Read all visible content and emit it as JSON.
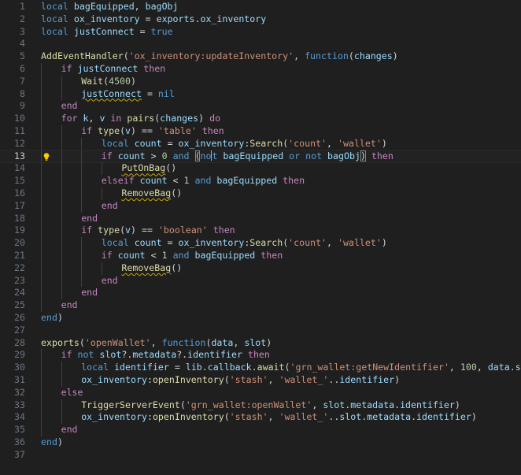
{
  "editor": {
    "language": "lua",
    "current_line": 13,
    "theme": {
      "background": "#1f1f1f",
      "keyword": "#569cd6",
      "control": "#c586c0",
      "variable": "#9cdcfe",
      "function": "#dcdcaa",
      "string": "#ce9178",
      "number": "#b5cea8",
      "line_number": "#6e7681"
    },
    "lines": [
      {
        "n": "1",
        "indent": 0,
        "tokens": [
          [
            "kw",
            "local "
          ],
          [
            "var",
            "bagEquipped"
          ],
          [
            "pun",
            ", "
          ],
          [
            "var",
            "bagObj"
          ]
        ]
      },
      {
        "n": "2",
        "indent": 0,
        "tokens": [
          [
            "kw",
            "local "
          ],
          [
            "var",
            "ox_inventory"
          ],
          [
            "op",
            " = "
          ],
          [
            "var",
            "exports"
          ],
          [
            "pun",
            "."
          ],
          [
            "var",
            "ox_inventory"
          ]
        ]
      },
      {
        "n": "3",
        "indent": 0,
        "tokens": [
          [
            "kw",
            "local "
          ],
          [
            "var",
            "justConnect"
          ],
          [
            "op",
            " = "
          ],
          [
            "kw",
            "true"
          ]
        ]
      },
      {
        "n": "4",
        "indent": 0,
        "tokens": []
      },
      {
        "n": "5",
        "indent": 0,
        "tokens": [
          [
            "fn",
            "AddEventHandler"
          ],
          [
            "pun",
            "("
          ],
          [
            "str",
            "'ox_inventory:updateInventory'"
          ],
          [
            "pun",
            ", "
          ],
          [
            "kw",
            "function"
          ],
          [
            "pun",
            "("
          ],
          [
            "var",
            "changes"
          ],
          [
            "pun",
            ")"
          ]
        ]
      },
      {
        "n": "6",
        "indent": 1,
        "tokens": [
          [
            "ctl",
            "if "
          ],
          [
            "var",
            "justConnect"
          ],
          [
            "ctl",
            " then"
          ]
        ]
      },
      {
        "n": "7",
        "indent": 2,
        "tokens": [
          [
            "fn",
            "Wait"
          ],
          [
            "pun",
            "("
          ],
          [
            "num",
            "4500"
          ],
          [
            "pun",
            ")"
          ]
        ]
      },
      {
        "n": "8",
        "indent": 2,
        "tokens": [
          [
            "var",
            "justConnect",
            "warn"
          ],
          [
            "op",
            " = "
          ],
          [
            "kw",
            "nil"
          ]
        ]
      },
      {
        "n": "9",
        "indent": 1,
        "tokens": [
          [
            "ctl",
            "end"
          ]
        ]
      },
      {
        "n": "10",
        "indent": 1,
        "tokens": [
          [
            "ctl",
            "for "
          ],
          [
            "var",
            "k"
          ],
          [
            "pun",
            ", "
          ],
          [
            "var",
            "v"
          ],
          [
            "ctl",
            " in "
          ],
          [
            "fn",
            "pairs"
          ],
          [
            "pun",
            "("
          ],
          [
            "var",
            "changes"
          ],
          [
            "pun",
            ")"
          ],
          [
            "ctl",
            " do"
          ]
        ]
      },
      {
        "n": "11",
        "indent": 2,
        "tokens": [
          [
            "ctl",
            "if "
          ],
          [
            "fn",
            "type"
          ],
          [
            "pun",
            "("
          ],
          [
            "var",
            "v"
          ],
          [
            "pun",
            ")"
          ],
          [
            "op",
            " == "
          ],
          [
            "str",
            "'table'"
          ],
          [
            "ctl",
            " then"
          ]
        ]
      },
      {
        "n": "12",
        "indent": 3,
        "tokens": [
          [
            "kw",
            "local "
          ],
          [
            "var",
            "count"
          ],
          [
            "op",
            " = "
          ],
          [
            "var",
            "ox_inventory"
          ],
          [
            "pun",
            ":"
          ],
          [
            "fn",
            "Search"
          ],
          [
            "pun",
            "("
          ],
          [
            "str",
            "'count'"
          ],
          [
            "pun",
            ", "
          ],
          [
            "str",
            "'wallet'"
          ],
          [
            "pun",
            ")"
          ]
        ]
      },
      {
        "n": "13",
        "indent": 3,
        "tokens": [
          [
            "ctl",
            "if "
          ],
          [
            "var",
            "count"
          ],
          [
            "op",
            " > "
          ],
          [
            "num",
            "0"
          ],
          [
            "kw",
            " and "
          ],
          [
            "pun",
            "(",
            "hl"
          ],
          [
            "kw",
            "no"
          ],
          [
            "cursor",
            ""
          ],
          [
            "kw",
            "t"
          ],
          [
            "txt",
            " "
          ],
          [
            "var",
            "bagEquipped"
          ],
          [
            "kw",
            " or not "
          ],
          [
            "var",
            "bagObj"
          ],
          [
            "pun",
            ")",
            "hl"
          ],
          [
            "ctl",
            " then"
          ]
        ]
      },
      {
        "n": "14",
        "indent": 4,
        "tokens": [
          [
            "fn",
            "PutOnBag",
            "warn"
          ],
          [
            "pun",
            "()"
          ]
        ]
      },
      {
        "n": "15",
        "indent": 3,
        "tokens": [
          [
            "ctl",
            "elseif "
          ],
          [
            "var",
            "count"
          ],
          [
            "op",
            " < "
          ],
          [
            "num",
            "1"
          ],
          [
            "kw",
            " and "
          ],
          [
            "var",
            "bagEquipped"
          ],
          [
            "ctl",
            " then"
          ]
        ]
      },
      {
        "n": "16",
        "indent": 4,
        "tokens": [
          [
            "fn",
            "RemoveBag",
            "warn"
          ],
          [
            "pun",
            "()"
          ]
        ]
      },
      {
        "n": "17",
        "indent": 3,
        "tokens": [
          [
            "ctl",
            "end"
          ]
        ]
      },
      {
        "n": "18",
        "indent": 2,
        "tokens": [
          [
            "ctl",
            "end"
          ]
        ]
      },
      {
        "n": "19",
        "indent": 2,
        "tokens": [
          [
            "ctl",
            "if "
          ],
          [
            "fn",
            "type"
          ],
          [
            "pun",
            "("
          ],
          [
            "var",
            "v"
          ],
          [
            "pun",
            ")"
          ],
          [
            "op",
            " == "
          ],
          [
            "str",
            "'boolean'"
          ],
          [
            "ctl",
            " then"
          ]
        ]
      },
      {
        "n": "20",
        "indent": 3,
        "tokens": [
          [
            "kw",
            "local "
          ],
          [
            "var",
            "count"
          ],
          [
            "op",
            " = "
          ],
          [
            "var",
            "ox_inventory"
          ],
          [
            "pun",
            ":"
          ],
          [
            "fn",
            "Search"
          ],
          [
            "pun",
            "("
          ],
          [
            "str",
            "'count'"
          ],
          [
            "pun",
            ", "
          ],
          [
            "str",
            "'wallet'"
          ],
          [
            "pun",
            ")"
          ]
        ]
      },
      {
        "n": "21",
        "indent": 3,
        "tokens": [
          [
            "ctl",
            "if "
          ],
          [
            "var",
            "count"
          ],
          [
            "op",
            " < "
          ],
          [
            "num",
            "1"
          ],
          [
            "kw",
            " and "
          ],
          [
            "var",
            "bagEquipped"
          ],
          [
            "ctl",
            " then"
          ]
        ]
      },
      {
        "n": "22",
        "indent": 4,
        "tokens": [
          [
            "fn",
            "RemoveBag",
            "warn"
          ],
          [
            "pun",
            "()"
          ]
        ]
      },
      {
        "n": "23",
        "indent": 3,
        "tokens": [
          [
            "ctl",
            "end"
          ]
        ]
      },
      {
        "n": "24",
        "indent": 2,
        "tokens": [
          [
            "ctl",
            "end"
          ]
        ]
      },
      {
        "n": "25",
        "indent": 1,
        "tokens": [
          [
            "ctl",
            "end"
          ]
        ]
      },
      {
        "n": "26",
        "indent": 0,
        "tokens": [
          [
            "kw",
            "end"
          ],
          [
            "pun",
            ")"
          ]
        ]
      },
      {
        "n": "27",
        "indent": 0,
        "tokens": []
      },
      {
        "n": "28",
        "indent": 0,
        "tokens": [
          [
            "fn",
            "exports"
          ],
          [
            "pun",
            "("
          ],
          [
            "str",
            "'openWallet'"
          ],
          [
            "pun",
            ", "
          ],
          [
            "kw",
            "function"
          ],
          [
            "pun",
            "("
          ],
          [
            "var",
            "data"
          ],
          [
            "pun",
            ", "
          ],
          [
            "var",
            "slot"
          ],
          [
            "pun",
            ")"
          ]
        ]
      },
      {
        "n": "29",
        "indent": 1,
        "tokens": [
          [
            "ctl",
            "if "
          ],
          [
            "kw",
            "not "
          ],
          [
            "var",
            "slot"
          ],
          [
            "pun",
            "?."
          ],
          [
            "var",
            "metadata"
          ],
          [
            "pun",
            "?."
          ],
          [
            "var",
            "identifier"
          ],
          [
            "ctl",
            " then"
          ]
        ]
      },
      {
        "n": "30",
        "indent": 2,
        "tokens": [
          [
            "kw",
            "local "
          ],
          [
            "var",
            "identifier"
          ],
          [
            "op",
            " = "
          ],
          [
            "var",
            "lib"
          ],
          [
            "pun",
            "."
          ],
          [
            "var",
            "callback"
          ],
          [
            "pun",
            "."
          ],
          [
            "fn",
            "await"
          ],
          [
            "pun",
            "("
          ],
          [
            "str",
            "'grn_wallet:getNewIdentifier'"
          ],
          [
            "pun",
            ", "
          ],
          [
            "num",
            "100"
          ],
          [
            "pun",
            ", "
          ],
          [
            "var",
            "data"
          ],
          [
            "pun",
            "."
          ],
          [
            "var",
            "slot"
          ],
          [
            "pun",
            ")"
          ]
        ]
      },
      {
        "n": "31",
        "indent": 2,
        "tokens": [
          [
            "var",
            "ox_inventory"
          ],
          [
            "pun",
            ":"
          ],
          [
            "fn",
            "openInventory"
          ],
          [
            "pun",
            "("
          ],
          [
            "str",
            "'stash'"
          ],
          [
            "pun",
            ", "
          ],
          [
            "str",
            "'wallet_'"
          ],
          [
            "op",
            ".."
          ],
          [
            "var",
            "identifier"
          ],
          [
            "pun",
            ")"
          ]
        ]
      },
      {
        "n": "32",
        "indent": 1,
        "tokens": [
          [
            "ctl",
            "else"
          ]
        ]
      },
      {
        "n": "33",
        "indent": 2,
        "tokens": [
          [
            "fn",
            "TriggerServerEvent"
          ],
          [
            "pun",
            "("
          ],
          [
            "str",
            "'grn_wallet:openWallet'"
          ],
          [
            "pun",
            ", "
          ],
          [
            "var",
            "slot"
          ],
          [
            "pun",
            "."
          ],
          [
            "var",
            "metadata"
          ],
          [
            "pun",
            "."
          ],
          [
            "var",
            "identifier"
          ],
          [
            "pun",
            ")"
          ]
        ]
      },
      {
        "n": "34",
        "indent": 2,
        "tokens": [
          [
            "var",
            "ox_inventory"
          ],
          [
            "pun",
            ":"
          ],
          [
            "fn",
            "openInventory"
          ],
          [
            "pun",
            "("
          ],
          [
            "str",
            "'stash'"
          ],
          [
            "pun",
            ", "
          ],
          [
            "str",
            "'wallet_'"
          ],
          [
            "op",
            ".."
          ],
          [
            "var",
            "slot"
          ],
          [
            "pun",
            "."
          ],
          [
            "var",
            "metadata"
          ],
          [
            "pun",
            "."
          ],
          [
            "var",
            "identifier"
          ],
          [
            "pun",
            ")"
          ]
        ]
      },
      {
        "n": "35",
        "indent": 1,
        "tokens": [
          [
            "ctl",
            "end"
          ]
        ]
      },
      {
        "n": "36",
        "indent": 0,
        "tokens": [
          [
            "kw",
            "end"
          ],
          [
            "pun",
            ")"
          ]
        ]
      },
      {
        "n": "37",
        "indent": 0,
        "tokens": []
      }
    ],
    "lightbulb_line": 13,
    "lightbulb_icon": "lightbulb-icon",
    "lightbulb_color": "#ffcc00"
  }
}
